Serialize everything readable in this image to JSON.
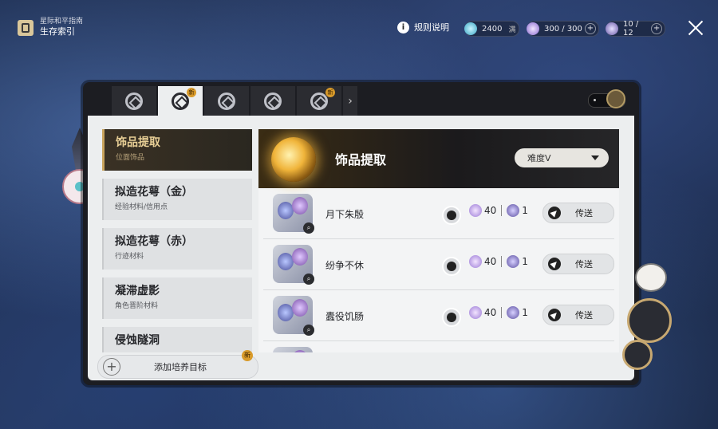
{
  "header": {
    "brand_subtitle": "星际和平指南",
    "brand_title": "生存索引",
    "rules_label": "规则说明",
    "currencies": [
      {
        "name": "trailblaze-power",
        "value": "2400",
        "suffix": "满"
      },
      {
        "name": "reserved-power",
        "value": "300 / 300",
        "suffix": "+"
      },
      {
        "name": "fuel",
        "value": "10 / 12",
        "suffix": "+"
      }
    ]
  },
  "tabs": [
    {
      "icon": "tab-icon-1",
      "new": false,
      "active": false
    },
    {
      "icon": "tab-icon-2",
      "new": true,
      "active": true
    },
    {
      "icon": "tab-icon-3",
      "new": false,
      "active": false
    },
    {
      "icon": "tab-icon-4",
      "new": false,
      "active": false
    },
    {
      "icon": "tab-icon-5",
      "new": true,
      "active": false
    }
  ],
  "new_badge": "新",
  "sidebar": {
    "items": [
      {
        "title": "饰品提取",
        "subtitle": "位面饰品",
        "active": true
      },
      {
        "title": "拟造花萼（金）",
        "subtitle": "经验材料/信用点",
        "active": false
      },
      {
        "title": "拟造花萼（赤）",
        "subtitle": "行迹材料",
        "active": false
      },
      {
        "title": "凝滞虚影",
        "subtitle": "角色晋阶材料",
        "active": false
      },
      {
        "title": "侵蚀隧洞",
        "subtitle": "",
        "active": false
      }
    ],
    "add_goal_label": "添加培养目标"
  },
  "content": {
    "banner_title": "饰品提取",
    "difficulty": "难度V",
    "rows": [
      {
        "name": "月下朱殷",
        "cost_power": "40",
        "cost_other": "1",
        "travel_label": "传送"
      },
      {
        "name": "纷争不休",
        "cost_power": "40",
        "cost_other": "1",
        "travel_label": "传送"
      },
      {
        "name": "蠹役饥肠",
        "cost_power": "40",
        "cost_other": "1",
        "travel_label": "传送"
      }
    ]
  }
}
